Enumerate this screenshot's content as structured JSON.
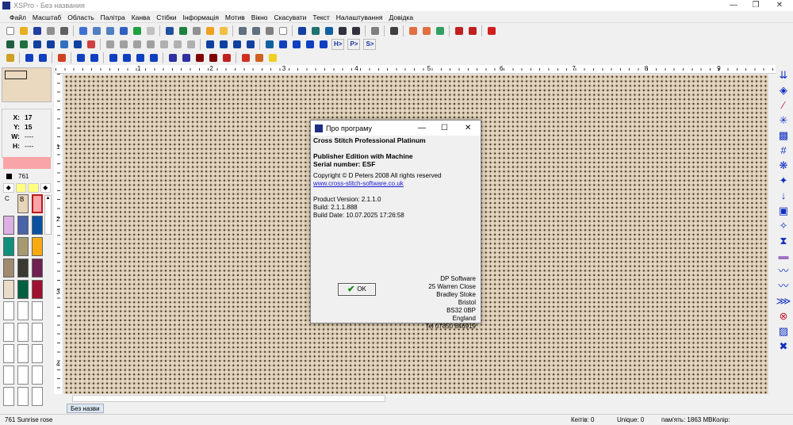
{
  "window": {
    "title": "XSPro - Без названия"
  },
  "menu": [
    "Файл",
    "Масштаб",
    "Область",
    "Палітра",
    "Канва",
    "Стібки",
    "Інформація",
    "Мотив",
    "Вікно",
    "Скасувати",
    "Текст",
    "Налаштування",
    "Довідка"
  ],
  "toolbar1": [
    {
      "name": "new-icon",
      "color": "#ffffff"
    },
    {
      "name": "open-icon",
      "color": "#e8b020"
    },
    {
      "name": "save-icon",
      "color": "#2040a0"
    },
    {
      "name": "print-icon",
      "color": "#909090"
    },
    {
      "name": "export-icon",
      "color": "#606060"
    },
    "sep",
    {
      "name": "select-rect-icon",
      "color": "#4070d0"
    },
    {
      "name": "edit-icon",
      "color": "#5080c0"
    },
    {
      "name": "lasso-icon",
      "color": "#5080c0"
    },
    {
      "name": "crosshair-icon",
      "color": "#3060c0"
    },
    {
      "name": "fill-icon",
      "color": "#20a040"
    },
    {
      "name": "disabled-icon",
      "color": "#c0c0c0"
    },
    "sep",
    {
      "name": "view-icon",
      "color": "#2050a0"
    },
    {
      "name": "zoom-select-icon",
      "color": "#208040"
    },
    {
      "name": "window-icon",
      "color": "#909090"
    },
    {
      "name": "hand-icon",
      "color": "#f0a020"
    },
    {
      "name": "hand2-icon",
      "color": "#f0c040"
    },
    "sep",
    {
      "name": "grid1-icon",
      "color": "#607080"
    },
    {
      "name": "grid2-icon",
      "color": "#607080"
    },
    {
      "name": "grid3-icon",
      "color": "#808080"
    },
    {
      "name": "blank-icon",
      "color": "#ffffff"
    },
    "sep",
    {
      "name": "stitch-view1-icon",
      "color": "#1040a0"
    },
    {
      "name": "stitch-view2-icon",
      "color": "#207070"
    },
    {
      "name": "stitch-view3-icon",
      "color": "#1060a0"
    },
    {
      "name": "stitch-view4-icon",
      "color": "#303040"
    },
    {
      "name": "stitch-view5-icon",
      "color": "#303040"
    },
    "sep",
    {
      "name": "dropdown-grid-icon",
      "color": "#808080"
    },
    "sep",
    {
      "name": "ruler-icon",
      "color": "#404040"
    },
    "sep",
    {
      "name": "pin-icon",
      "color": "#e07040"
    },
    {
      "name": "pin2-icon",
      "color": "#e07040"
    },
    {
      "name": "check-icon",
      "color": "#30a060"
    },
    "sep",
    {
      "name": "marker-icon",
      "color": "#c02020"
    },
    {
      "name": "marker2-icon",
      "color": "#c02020"
    },
    "sep",
    {
      "name": "delete-x-icon",
      "color": "#d02020"
    }
  ],
  "toolbar2": [
    {
      "name": "paint-icon",
      "color": "#206040"
    },
    {
      "name": "needle-icon",
      "color": "#207040"
    },
    {
      "name": "needle2-icon",
      "color": "#1040a0"
    },
    {
      "name": "needle3-icon",
      "color": "#1040a0"
    },
    {
      "name": "text-icon",
      "color": "#3070c0"
    },
    {
      "name": "text-bold-icon",
      "color": "#1040a0"
    },
    {
      "name": "dotted-rect-icon",
      "color": "#d04040"
    },
    "sep",
    {
      "name": "cut-icon",
      "color": "#a0a0a0"
    },
    {
      "name": "copy-icon",
      "color": "#a0a0a0"
    },
    {
      "name": "paste-icon",
      "color": "#a0a0a0"
    },
    {
      "name": "paste2-icon",
      "color": "#a0a0a0"
    },
    {
      "name": "flip-icon",
      "color": "#b0b0b0"
    },
    {
      "name": "rotate-icon",
      "color": "#b0b0b0"
    },
    {
      "name": "gear-disabled-icon",
      "color": "#b0b0b0"
    },
    "sep",
    {
      "name": "undo-icon",
      "color": "#1040a0"
    },
    {
      "name": "redo-icon",
      "color": "#1040a0"
    },
    {
      "name": "mirror-icon",
      "color": "#1040a0"
    },
    {
      "name": "mirror2-icon",
      "color": "#1040a0"
    },
    "sep",
    {
      "name": "stitch-x-icon",
      "color": "#1060a0"
    },
    {
      "name": "stitch-x2-icon",
      "color": "#1040c0"
    },
    {
      "name": "stitch-x3-icon",
      "color": "#1040c0"
    },
    {
      "name": "stitch-x4-icon",
      "color": "#1040c0"
    },
    {
      "name": "stitch-x5-icon",
      "color": "#1040c0"
    }
  ],
  "toolbar2_buttons": [
    "H>",
    "P>",
    "S>"
  ],
  "toolbar3": [
    {
      "name": "pencil-icon",
      "color": "#d0a020"
    },
    "sep",
    {
      "name": "cross-stitch-icon",
      "color": "#1040c0"
    },
    {
      "name": "cross-erase-icon",
      "color": "#1040c0"
    },
    "sep",
    {
      "name": "half-stitch-erase-icon",
      "color": "#d04020"
    },
    "sep",
    {
      "name": "half-stitch-icon",
      "color": "#1040c0"
    },
    {
      "name": "half-stitch2-icon",
      "color": "#1040c0"
    },
    "sep",
    {
      "name": "bead-oval-icon",
      "color": "#1040c0"
    },
    {
      "name": "bead-large-icon",
      "color": "#1040c0"
    },
    {
      "name": "bead-small-icon",
      "color": "#1040c0"
    },
    {
      "name": "bead-split-icon",
      "color": "#1040c0"
    },
    "sep",
    {
      "name": "backstitch-icon",
      "color": "#3030a0"
    },
    {
      "name": "backstitch2-icon",
      "color": "#3030a0"
    },
    {
      "name": "curve-icon",
      "color": "#800000"
    },
    {
      "name": "curve2-icon",
      "color": "#800000"
    },
    {
      "name": "eraser-icon",
      "color": "#c02020"
    },
    "sep",
    {
      "name": "line-icon",
      "color": "#d03020"
    },
    {
      "name": "arc-icon",
      "color": "#d06020"
    },
    {
      "name": "circle-icon",
      "color": "#f0d020"
    }
  ],
  "ruler": {
    "h_labels": [
      "1",
      "2",
      "3",
      "4",
      "5",
      "6",
      "7",
      "8",
      "9"
    ],
    "v_labels": [
      "1",
      "2",
      "3",
      "4"
    ]
  },
  "right_toolbar": [
    "specialty-stitch-1-icon",
    "specialty-stitch-2-icon",
    "specialty-stitch-3-icon",
    "specialty-stitch-4-icon",
    "specialty-stitch-5-icon",
    "specialty-stitch-6-icon",
    "specialty-stitch-7-icon",
    "specialty-stitch-8-icon",
    "specialty-stitch-9-icon",
    "specialty-stitch-10-icon",
    "specialty-stitch-11-icon",
    "specialty-stitch-12-icon",
    "specialty-stitch-13-icon",
    "specialty-stitch-14-icon",
    "specialty-stitch-15-icon",
    "specialty-stitch-16-icon",
    "specialty-stitch-17-icon",
    "specialty-stitch-18-icon",
    "specialty-stitch-19-icon"
  ],
  "right_toolbar_glyphs": [
    "⇊",
    "◈",
    "⁄",
    "✳",
    "▩",
    "#",
    "❋",
    "✦",
    "↓",
    "▣",
    "✧",
    "⧗",
    "▬",
    "〰",
    "〰",
    "⋙",
    "⊗",
    "▨",
    "✖"
  ],
  "coords": {
    "x_label": "X:",
    "x": "17",
    "y_label": "Y:",
    "y": "15",
    "w_label": "W:",
    "w": "----",
    "h_label": "H:",
    "h": "----"
  },
  "current_color": {
    "hex": "#f8a4a8",
    "code": "761"
  },
  "symbols": [
    "◆",
    "",
    "",
    "◆"
  ],
  "palette": [
    {
      "label": "C",
      "color": "#f0f0f0"
    },
    {
      "label": "B",
      "color": "#e8d4b8"
    },
    {
      "label": "",
      "color": "#f8a4a8",
      "selected": true
    },
    {
      "label": "",
      "color": "#dcb0e4"
    },
    {
      "label": "",
      "color": "#4a62a8"
    },
    {
      "label": "",
      "color": "#0a52a0"
    },
    {
      "label": "",
      "color": "#10907a"
    },
    {
      "label": "",
      "color": "#a89a70"
    },
    {
      "label": "",
      "color": "#f8aa10"
    },
    {
      "label": "",
      "color": "#a08a70"
    },
    {
      "label": "",
      "color": "#3a3a32"
    },
    {
      "label": "",
      "color": "#702050"
    },
    {
      "label": "",
      "color": "#eadcc8"
    },
    {
      "label": "",
      "color": "#006040"
    },
    {
      "label": "",
      "color": "#a01030"
    }
  ],
  "empty_palette_slots": 15,
  "tab": {
    "label": "Без назви"
  },
  "status": {
    "color_name": "761 Sunrise rose",
    "stitches": "Кеітів: 0",
    "unique": "Unique: 0",
    "memory": "пам'ять: 1863 MBКолір:"
  },
  "dialog": {
    "title": "Про програму",
    "product": "Cross Stitch Professional Platinum",
    "edition": "Publisher Edition with Machine",
    "serial": "Serial number: ESF",
    "copyright": "Copyright © D Peters 2008 All rights reserved",
    "website": "www.cross-stitch-software.co.uk",
    "version": "Product Version: 2.1.1.0",
    "build": "Build: 2.1.1.888",
    "build_date": "Build Date: 10.07.2025 17:26:58",
    "address": [
      "DP Software",
      "25 Warren Close",
      "Bradley Stoke",
      "Bristol",
      "BS32 0BP",
      "England",
      "Tel 07850 846919"
    ],
    "ok_label": "OK"
  }
}
